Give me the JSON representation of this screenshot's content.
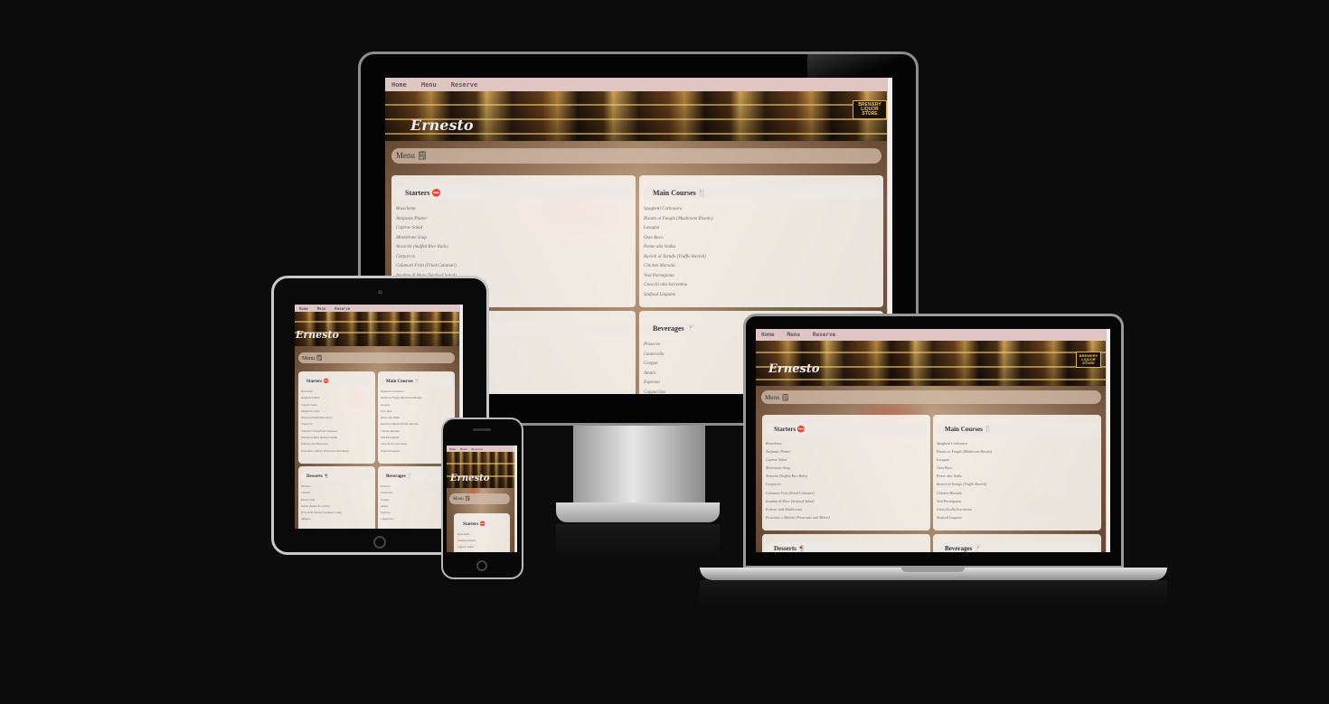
{
  "nav": {
    "home": "Home",
    "menu": "Menu",
    "reserve": "Reserve"
  },
  "brand": {
    "name": "Ernesto",
    "sign_line1": "BREWERY",
    "sign_line2": "LIQUOR",
    "sign_line3": "STORE"
  },
  "menu_bar": {
    "label": "Menu 🗒"
  },
  "sections": {
    "starters": {
      "title": "Starters ⛔",
      "items": [
        "Bruschetta",
        "Antipasto Platter",
        "Caprese Salad",
        "Minestrone Soup",
        "Arancini (Stuffed Rice Balls)",
        "Carpaccio",
        "Calamari Fritti (Fried Calamari)",
        "Insalata di Mare (Seafood Salad)",
        "Polenta with Mushrooms",
        "Prosciutto e Melone (Prosciutto and Melon)"
      ]
    },
    "mains": {
      "title": "Main Courses 🍴",
      "items": [
        "Spaghetti Carbonara",
        "Risotto ai Funghi (Mushroom Risotto)",
        "Lasagna",
        "Osso Buco",
        "Penne alla Vodka",
        "Ravioli al Tartufo (Truffle Ravioli)",
        "Chicken Marsala",
        "Veal Parmigiana",
        "Gnocchi alla Sorrentina",
        "Seafood Linguine"
      ]
    },
    "desserts": {
      "title": "Desserts 🍨",
      "items": [
        "Tiramisu",
        "Cannoli",
        "Panna Cotta",
        "Gelato (Italian Ice cream)",
        "Torta della Nonna (Grandma's Cake)",
        "Affogato"
      ]
    },
    "beverages": {
      "title": "Beverages 🍸",
      "items": [
        "Prosecco",
        "Limoncello",
        "Grappa",
        "Amaro",
        "Espresso",
        "Cappuccino"
      ]
    }
  },
  "colors": {
    "background": "#0c0c0d",
    "nav": "#dfc6c4",
    "card": "#f8f4f0"
  }
}
